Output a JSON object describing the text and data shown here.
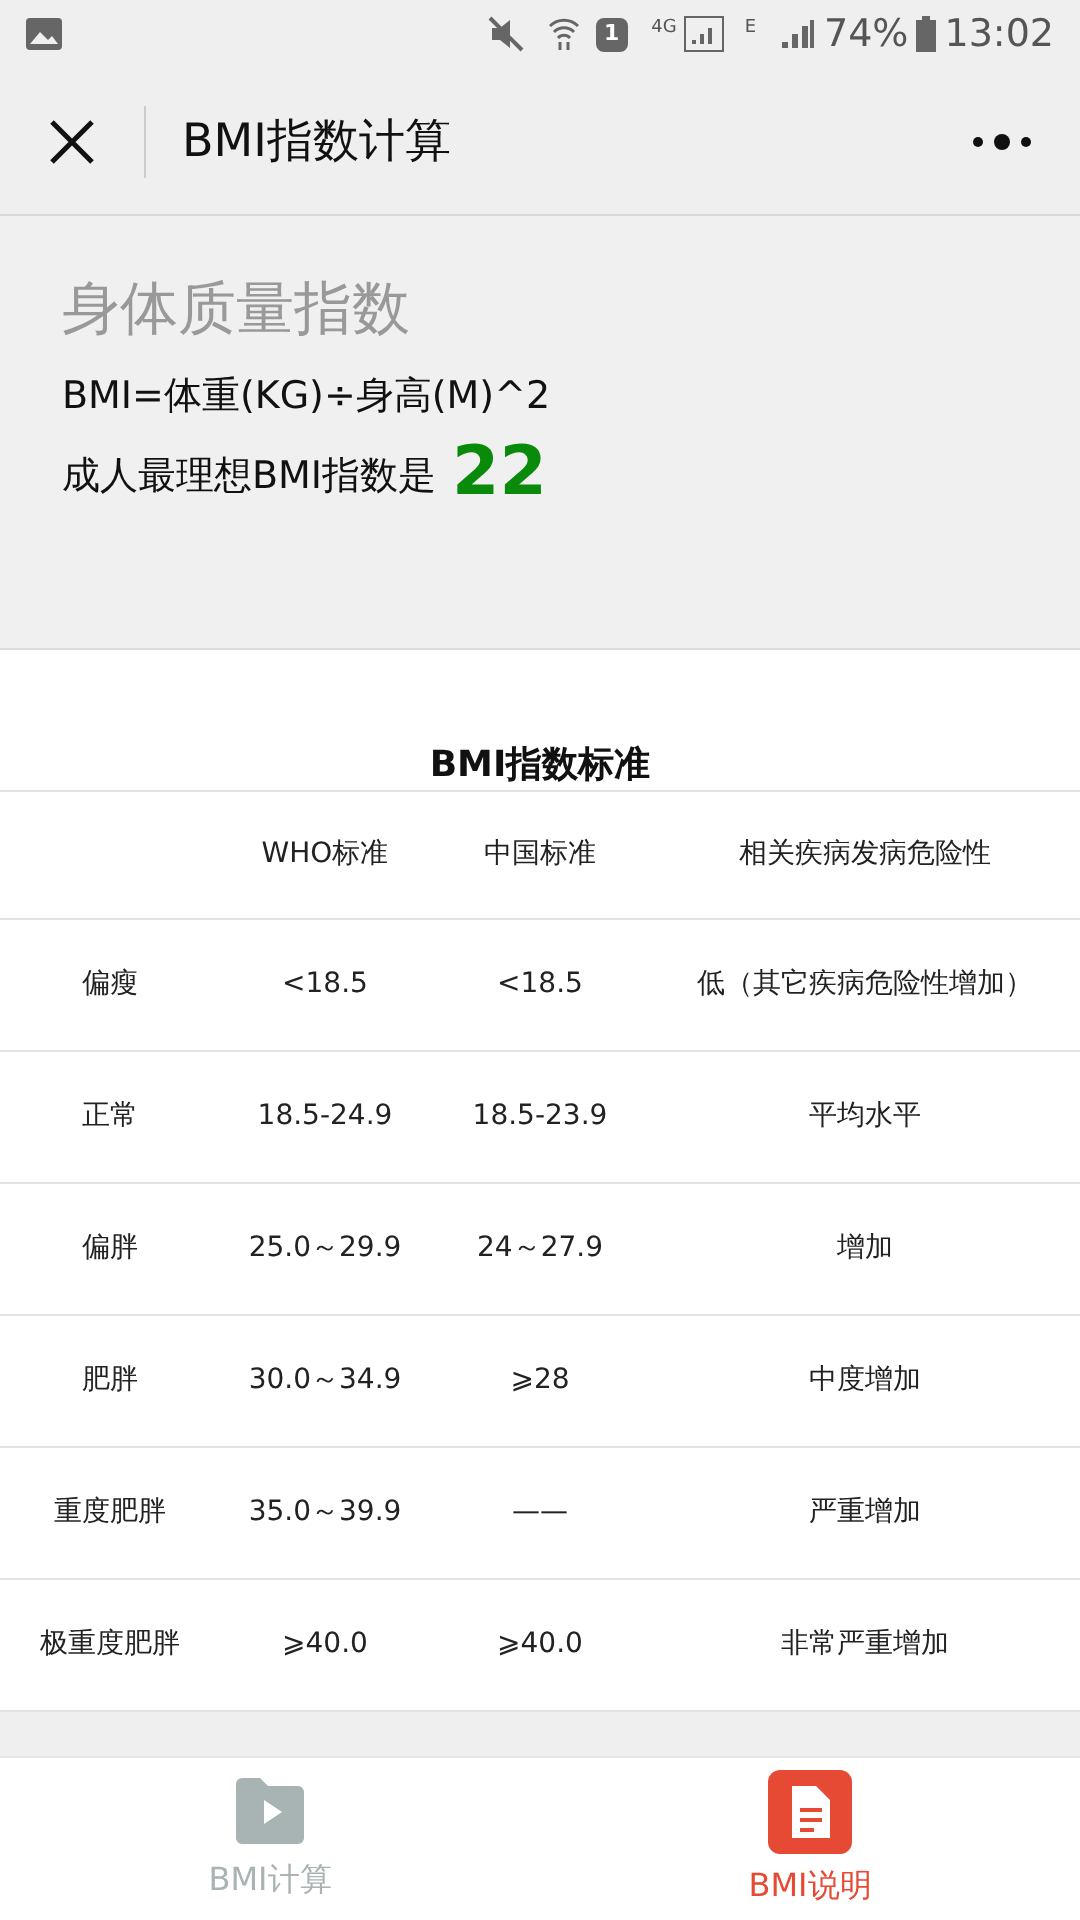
{
  "status_bar": {
    "battery": "74%",
    "time": "13:02",
    "network_1": "4G",
    "network_2": "E",
    "sim": "1"
  },
  "nav": {
    "title": "BMI指数计算"
  },
  "info": {
    "heading": "身体质量指数",
    "formula": "BMI=体重(KG)÷身高(M)^2",
    "ideal_label": "成人最理想BMI指数是",
    "ideal_value": "22"
  },
  "table": {
    "title": "BMI指数标准",
    "columns": [
      "",
      "WHO标准",
      "中国标准",
      "相关疾病发病危险性"
    ],
    "rows": [
      [
        "偏瘦",
        "<18.5",
        "<18.5",
        "低（其它疾病危险性增加）"
      ],
      [
        "正常",
        "18.5-24.9",
        "18.5-23.9",
        "平均水平"
      ],
      [
        "偏胖",
        "25.0～29.9",
        "24～27.9",
        "增加"
      ],
      [
        "肥胖",
        "30.0～34.9",
        "⩾28",
        "中度增加"
      ],
      [
        "重度肥胖",
        "35.0～39.9",
        "——",
        "严重增加"
      ],
      [
        "极重度肥胖",
        "⩾40.0",
        "⩾40.0",
        "非常严重增加"
      ]
    ]
  },
  "tab_bar": [
    {
      "label": "BMI计算",
      "kind": "calc",
      "selected": false
    },
    {
      "label": "BMI说明",
      "kind": "doc",
      "selected": true
    }
  ]
}
